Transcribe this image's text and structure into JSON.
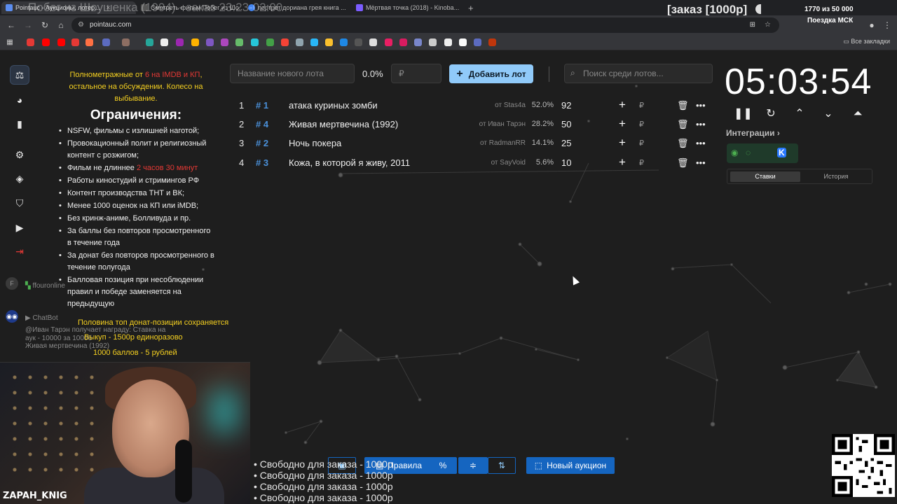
{
  "browser": {
    "tabs": [
      {
        "label": "Pointauc - Аукционы, лотер...",
        "active": true
      },
      {
        "label": "Смотреть фильм Побег из Шо...",
        "active": false
      },
      {
        "label": "портрет дориана грея книга ...",
        "active": false
      },
      {
        "label": "Мёртвая точка (2018) - Kinoba...",
        "active": false
      }
    ],
    "new_tab": "+",
    "url": "pointauc.com",
    "all_bookmarks": "Все закладки"
  },
  "overlay": {
    "title": "Побег из Шоушенка (1994) - заказ 23:23-02:00",
    "order": "[заказ [1000р]",
    "goal": "1770  из 50 000",
    "goal_sub": "Поездка МСК"
  },
  "rules": {
    "intro_a": "Полнометражные от ",
    "intro_red": "6 на IMDB и КП",
    "intro_b": ", остальное на обсуждении. Колесо на выбывание.",
    "heading": "Ограничения:",
    "items": [
      {
        "text": "NSFW, фильмы с излишней наготой;"
      },
      {
        "text": "Провокационный полит и религиозный контент с розжигом;"
      },
      {
        "text": "Фильм не длиннее ",
        "red": "2 часов 30 минут"
      },
      {
        "text": "Работы киностудий и стримингов РФ"
      },
      {
        "text": "Контент производства ТНТ и ВК;"
      },
      {
        "text": "Менее 1000 оценок на КП или iMDB;"
      },
      {
        "text": "Без кринж-аниме, Болливуда и пр."
      },
      {
        "text": "За баллы без повторов просмотренного в течение года"
      },
      {
        "text": "За донат без повторов просмотренного в течение полугода"
      },
      {
        "text": "Балловая позиция при несоблюдении правил и победе заменяется на предыдущую"
      }
    ],
    "donate_line": "Половина топ донат-позиции сохраняется",
    "buyout_line": "Выкуп - 1500р единоразово",
    "points_line": "1000 баллов - 5 рублей"
  },
  "chat": {
    "user1_name": "ffouronline",
    "user1_initial": "F",
    "bot_name": "ChatBot",
    "bot_msg_1": "@Иван Тарэн получает награду: Ставка на",
    "bot_msg_2": "аук -  10000 за 1000б",
    "bot_msg_3": "Живая мертвечина (1992)"
  },
  "webcam": {
    "streamer": "ZAPAH_KNIG"
  },
  "controls": {
    "lot_name_placeholder": "Название нового лота",
    "percent": "0.0%",
    "amount_placeholder": "₽",
    "add_lot_label": "Добавить лот",
    "search_placeholder": "Поиск среди лотов..."
  },
  "lots": [
    {
      "rank": "1",
      "id": "# 1",
      "name": "атака куриных зомби",
      "from": "от Stas4a",
      "pct": "52.0%",
      "amount": "92"
    },
    {
      "rank": "2",
      "id": "# 4",
      "name": "Живая мертвечина (1992)",
      "from": "от Иван Тарэн",
      "pct": "28.2%",
      "amount": "50"
    },
    {
      "rank": "3",
      "id": "# 2",
      "name": "Ночь покера",
      "from": "от RadmanRR",
      "pct": "14.1%",
      "amount": "25"
    },
    {
      "rank": "4",
      "id": "# 3",
      "name": "Кожа, в которой я живу, 2011",
      "from": "от SayVoid",
      "pct": "5.6%",
      "amount": "10"
    }
  ],
  "lot_row_buttons": {
    "plus": "+",
    "rub": "₽"
  },
  "timer": {
    "value": "05:03:54"
  },
  "integrations": {
    "label": "Интеграции",
    "chevron": "›"
  },
  "bet_tabs": {
    "bets": "Ставки",
    "history": "История"
  },
  "bottom_bar": {
    "rules_label": "Правила",
    "percent_symbol": "%",
    "new_auction_label": "Новый аукцион"
  },
  "free_slots": [
    "• Свободно для заказа - 1000р",
    "• Свободно для заказа - 1000р",
    "• Свободно для заказа - 1000р",
    "• Свободно для заказа - 1000р"
  ],
  "colors": {
    "accent": "#90caf9",
    "id_blue": "#4a90d9",
    "rules_yellow": "#f5d020",
    "rules_red": "#e53935",
    "toolbar_blue": "#1565c0"
  }
}
